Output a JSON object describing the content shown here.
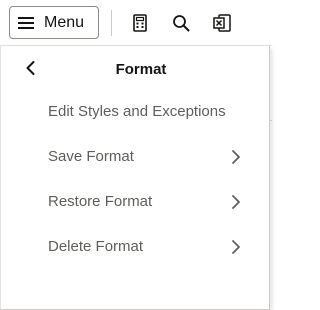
{
  "toolbar": {
    "menu_label": "Menu",
    "icons": [
      "calculator-icon",
      "search-icon",
      "excel-export-icon"
    ]
  },
  "panel": {
    "title": "Format",
    "items": [
      {
        "label": "Edit Styles and Exceptions",
        "has_submenu": false
      },
      {
        "label": "Save Format",
        "has_submenu": true
      },
      {
        "label": "Restore Format",
        "has_submenu": true
      },
      {
        "label": "Delete Format",
        "has_submenu": true
      }
    ]
  },
  "colors": {
    "text": "#161513",
    "muted_text": "#5f5e5a",
    "border": "#8f8c88"
  }
}
